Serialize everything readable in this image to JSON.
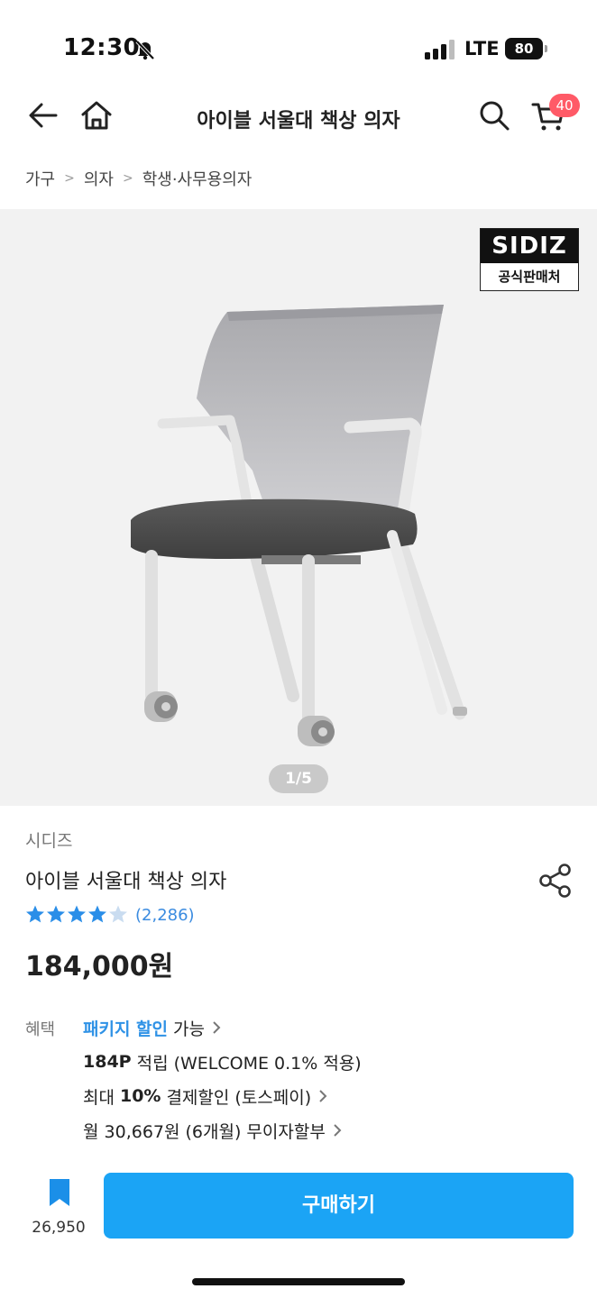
{
  "status_bar": {
    "time": "12:30",
    "network": "LTE",
    "battery": "80"
  },
  "header": {
    "title": "아이블 서울대 책상 의자",
    "cart_count": "40"
  },
  "breadcrumb": {
    "items": [
      "가구",
      "의자",
      "학생·사무용의자"
    ]
  },
  "gallery": {
    "brand_name": "SIDIZ",
    "brand_sub": "공식판매처",
    "page_indicator": "1/5"
  },
  "product": {
    "brand": "시디즈",
    "title": "아이블 서울대 책상 의자",
    "rating": 4.7,
    "review_count": "(2,286)",
    "price": "184,000원"
  },
  "benefits": {
    "label": "혜택",
    "package_discount": "패키지 할인",
    "package_available": "가능",
    "points_amount": "184P",
    "points_text": "적립 (WELCOME 0.1% 적용)",
    "max_prefix": "최대",
    "max_percent": "10%",
    "max_text": "결제할인 (토스페이)",
    "installment": "월 30,667원 (6개월) 무이자할부"
  },
  "bottom_bar": {
    "wishlist_count": "26,950",
    "buy_label": "구매하기"
  },
  "colors": {
    "accent": "#1ba4f5",
    "link": "#2f92e6",
    "badge": "#ff5a67",
    "star": "#2a8ee8"
  }
}
